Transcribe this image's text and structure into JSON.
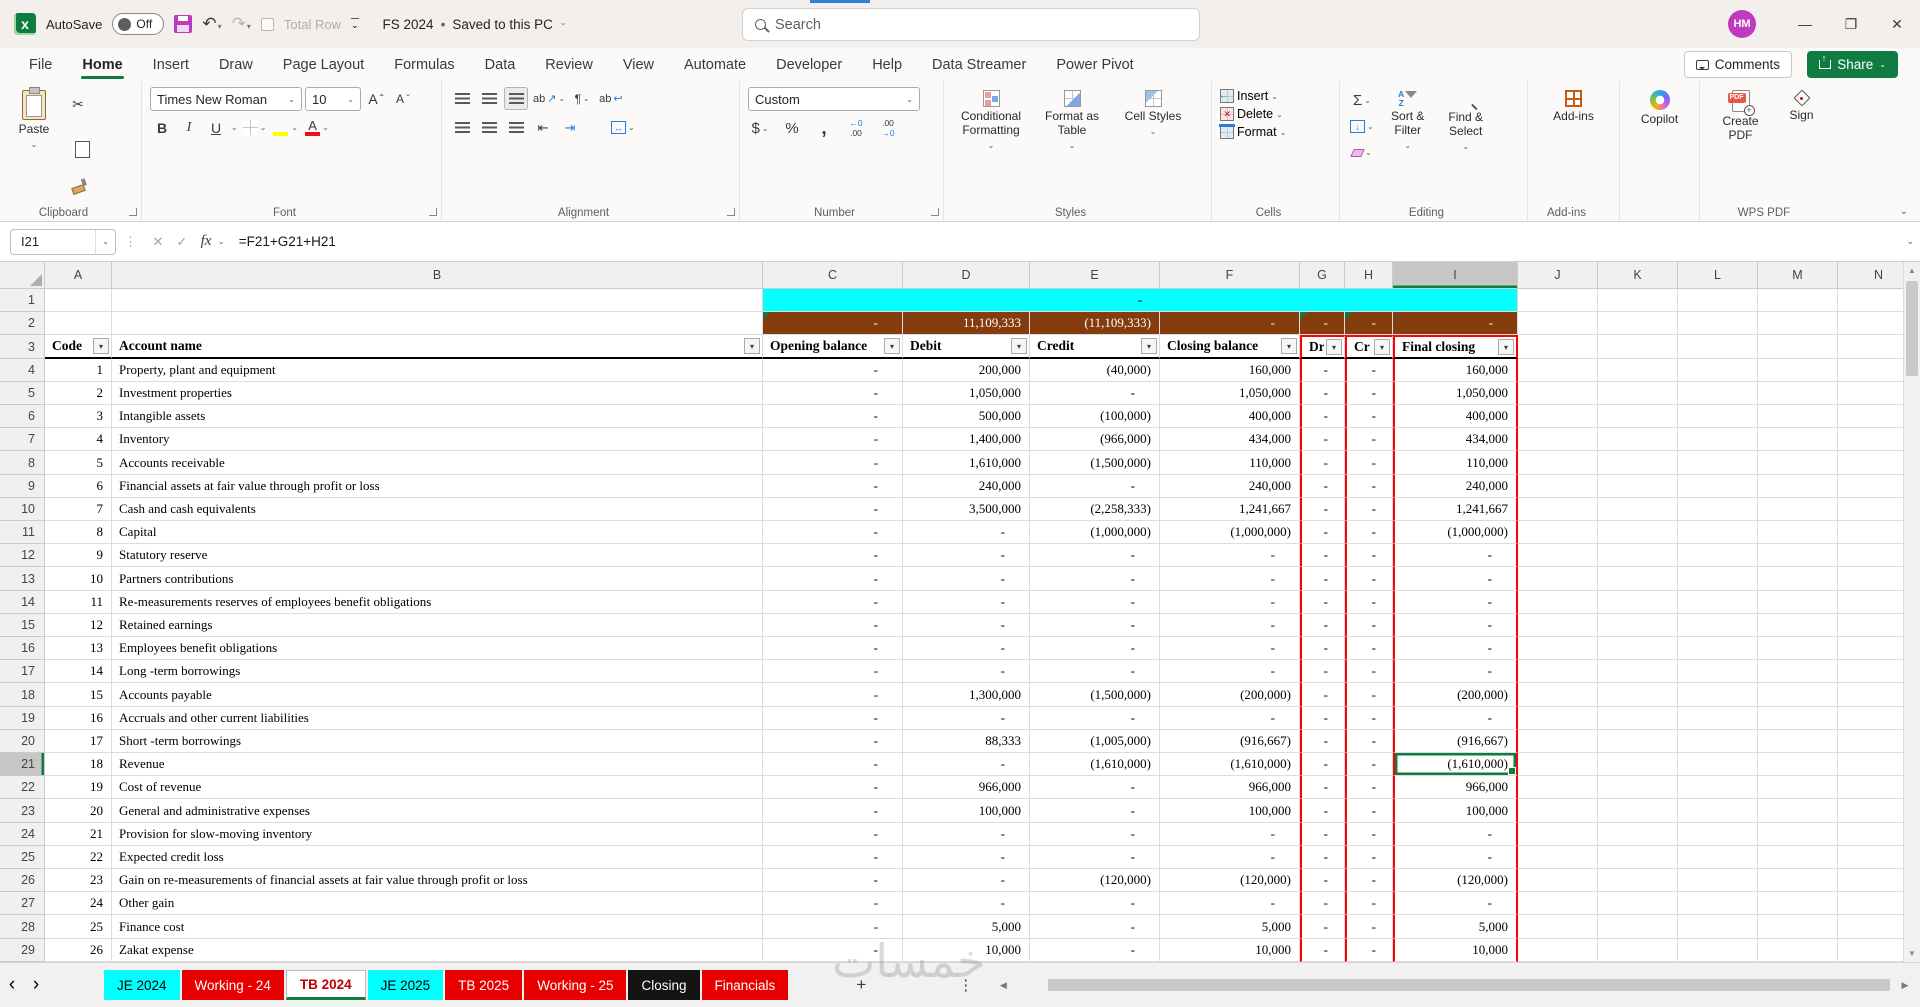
{
  "window": {
    "titlebar": {
      "autosave_label": "AutoSave",
      "autosave_state": "Off",
      "total_row_label": "Total Row",
      "doc_name": "FS 2024",
      "doc_sep": "•",
      "doc_status": "Saved to this PC",
      "search_placeholder": "Search",
      "avatar": "HM"
    },
    "controls": {
      "minimize": "—",
      "restore": "❐",
      "close": "✕"
    }
  },
  "menu": {
    "tabs": [
      {
        "label": "File"
      },
      {
        "label": "Home",
        "active": true
      },
      {
        "label": "Insert"
      },
      {
        "label": "Draw"
      },
      {
        "label": "Page Layout"
      },
      {
        "label": "Formulas"
      },
      {
        "label": "Data"
      },
      {
        "label": "Review"
      },
      {
        "label": "View"
      },
      {
        "label": "Automate"
      },
      {
        "label": "Developer"
      },
      {
        "label": "Help"
      },
      {
        "label": "Data Streamer"
      },
      {
        "label": "Power Pivot"
      }
    ],
    "comments_label": "Comments",
    "share_label": "Share"
  },
  "icons": {
    "caret": "▾",
    "chev": "⌄",
    "undo": "↶",
    "redo": "↷",
    "scissors": "✂",
    "filter": "▾",
    "dots_v": "⋮",
    "nav_l": "‹",
    "nav_r": "›",
    "tri_l": "◀",
    "tri_r": "▶",
    "tri_u": "▲",
    "tri_d": "▼",
    "plus": "+",
    "down": "↓",
    "lr": "↔",
    "wrap": "↩",
    "orient": "↗",
    "para": "¶",
    "ind_l": "⇤",
    "ind_r": "⇥",
    "up_hat": "ˆ",
    "down_hat": "ˇ",
    "ab": "ab",
    "az1": "A",
    "az2": "Z",
    "inc1": "←0",
    "inc2": ".00",
    "dec1": ".00",
    "dec2": "→0"
  },
  "ribbon": {
    "clipboard": {
      "group": "Clipboard",
      "paste": "Paste"
    },
    "font": {
      "group": "Font",
      "name": "Times New Roman",
      "size": "10",
      "bold": "B",
      "italic": "I",
      "underline": "U",
      "a": "A"
    },
    "alignment": {
      "group": "Alignment"
    },
    "number": {
      "group": "Number",
      "format": "Custom",
      "currency": "$",
      "percent": "%",
      "comma": ","
    },
    "styles": {
      "group": "Styles",
      "buttons": [
        {
          "label": "Conditional Formatting",
          "icon": "cf",
          "caret": true
        },
        {
          "label": "Format as Table",
          "icon": "fat",
          "caret": true
        },
        {
          "label": "Cell Styles",
          "icon": "cs",
          "caret": true
        }
      ]
    },
    "cells": {
      "group": "Cells",
      "buttons": [
        {
          "label": "Insert",
          "icon": "ins",
          "caret": true
        },
        {
          "label": "Delete",
          "icon": "del",
          "caret": true
        },
        {
          "label": "Format",
          "icon": "fmt",
          "caret": true
        }
      ]
    },
    "editing": {
      "group": "Editing",
      "sum": "Σ",
      "sort": "Sort & Filter",
      "find": "Find & Select"
    },
    "addins": {
      "group": "Add-ins",
      "button": "Add-ins"
    },
    "copilot": {
      "button": "Copilot"
    },
    "wpspdf": {
      "group": "WPS PDF",
      "buttons": [
        {
          "label": "Create PDF",
          "icon": "pdf"
        },
        {
          "label": "Sign",
          "icon": "sign"
        }
      ]
    }
  },
  "formula_bar": {
    "name_box": "I21",
    "cancel": "✕",
    "enter": "✓",
    "fx": "fx",
    "formula": "=F21+G21+H21"
  },
  "grid": {
    "col_letters": [
      "A",
      "B",
      "C",
      "D",
      "E",
      "F",
      "G",
      "H",
      "I",
      "J",
      "K",
      "L",
      "M",
      "N"
    ],
    "selected_col": "I",
    "selected_row": 21,
    "row1_merged": "-",
    "row2": {
      "values": {
        "C": "-",
        "D": "11,109,333",
        "E": "(11,109,333)",
        "F": "-",
        "G": "-",
        "H": "-",
        "I": "-"
      },
      "error_markers": [
        "C",
        "G",
        "H"
      ]
    },
    "headers": {
      "A": "Code",
      "B": "Account name",
      "C": "Opening balance",
      "D": "Debit",
      "E": "Credit",
      "F": "Closing balance",
      "G": "Dr",
      "H": "Cr",
      "I": "Final closing"
    },
    "rows": [
      [
        "1",
        "Property, plant and equipment",
        "-",
        "200,000",
        "(40,000)",
        "160,000",
        "-",
        "-",
        "160,000"
      ],
      [
        "2",
        "Investment properties",
        "-",
        "1,050,000",
        "-",
        "1,050,000",
        "-",
        "-",
        "1,050,000"
      ],
      [
        "3",
        "Intangible assets",
        "-",
        "500,000",
        "(100,000)",
        "400,000",
        "-",
        "-",
        "400,000"
      ],
      [
        "4",
        "Inventory",
        "-",
        "1,400,000",
        "(966,000)",
        "434,000",
        "-",
        "-",
        "434,000"
      ],
      [
        "5",
        "Accounts receivable",
        "-",
        "1,610,000",
        "(1,500,000)",
        "110,000",
        "-",
        "-",
        "110,000"
      ],
      [
        "6",
        "Financial assets at fair value through profit or loss",
        "-",
        "240,000",
        "-",
        "240,000",
        "-",
        "-",
        "240,000"
      ],
      [
        "7",
        "Cash and cash equivalents",
        "-",
        "3,500,000",
        "(2,258,333)",
        "1,241,667",
        "-",
        "-",
        "1,241,667"
      ],
      [
        "8",
        "Capital",
        "-",
        "-",
        "(1,000,000)",
        "(1,000,000)",
        "-",
        "-",
        "(1,000,000)"
      ],
      [
        "9",
        "Statutory reserve",
        "-",
        "-",
        "-",
        "-",
        "-",
        "-",
        "-"
      ],
      [
        "10",
        "Partners contributions",
        "-",
        "-",
        "-",
        "-",
        "-",
        "-",
        "-"
      ],
      [
        "11",
        "Re-measurements reserves of employees benefit obligations",
        "-",
        "-",
        "-",
        "-",
        "-",
        "-",
        "-"
      ],
      [
        "12",
        "Retained earnings",
        "-",
        "-",
        "-",
        "-",
        "-",
        "-",
        "-"
      ],
      [
        "13",
        "Employees benefit obligations",
        "-",
        "-",
        "-",
        "-",
        "-",
        "-",
        "-"
      ],
      [
        "14",
        "Long -term borrowings",
        "-",
        "-",
        "-",
        "-",
        "-",
        "-",
        "-"
      ],
      [
        "15",
        "Accounts payable",
        "-",
        "1,300,000",
        "(1,500,000)",
        "(200,000)",
        "-",
        "-",
        "(200,000)"
      ],
      [
        "16",
        "Accruals and other current liabilities",
        "-",
        "-",
        "-",
        "-",
        "-",
        "-",
        "-"
      ],
      [
        "17",
        "Short -term borrowings",
        "-",
        "88,333",
        "(1,005,000)",
        "(916,667)",
        "-",
        "-",
        "(916,667)"
      ],
      [
        "18",
        "Revenue",
        "-",
        "-",
        "(1,610,000)",
        "(1,610,000)",
        "-",
        "-",
        "(1,610,000)"
      ],
      [
        "19",
        "Cost of revenue",
        "-",
        "966,000",
        "-",
        "966,000",
        "-",
        "-",
        "966,000"
      ],
      [
        "20",
        "General and administrative expenses",
        "-",
        "100,000",
        "-",
        "100,000",
        "-",
        "-",
        "100,000"
      ],
      [
        "21",
        "Provision for slow-moving inventory",
        "-",
        "-",
        "-",
        "-",
        "-",
        "-",
        "-"
      ],
      [
        "22",
        "Expected credit loss",
        "-",
        "-",
        "-",
        "-",
        "-",
        "-",
        "-"
      ],
      [
        "23",
        "Gain on re-measurements of financial assets at fair value through profit or loss",
        "-",
        "-",
        "(120,000)",
        "(120,000)",
        "-",
        "-",
        "(120,000)"
      ],
      [
        "24",
        "Other gain",
        "-",
        "-",
        "-",
        "-",
        "-",
        "-",
        "-"
      ],
      [
        "25",
        "Finance cost",
        "-",
        "5,000",
        "-",
        "5,000",
        "-",
        "-",
        "5,000"
      ],
      [
        "26",
        "Zakat expense",
        "-",
        "10,000",
        "-",
        "10,000",
        "-",
        "-",
        "10,000"
      ]
    ]
  },
  "sheet_bar": {
    "tabs": [
      {
        "label": "JE 2024",
        "bg": "#00FFFF",
        "fg": "#000000"
      },
      {
        "label": "Working - 24",
        "bg": "#E80000",
        "fg": "#FFFFFF"
      },
      {
        "label": "TB 2024",
        "bg": "#FFFFFF",
        "fg": "#C00000",
        "active": true
      },
      {
        "label": "JE 2025",
        "bg": "#00FFFF",
        "fg": "#000000"
      },
      {
        "label": "TB 2025",
        "bg": "#E80000",
        "fg": "#FFFFFF"
      },
      {
        "label": "Working - 25",
        "bg": "#E80000",
        "fg": "#FFFFFF"
      },
      {
        "label": "Closing",
        "bg": "#141414",
        "fg": "#FFFFFF"
      },
      {
        "label": "Financials",
        "bg": "#E80000",
        "fg": "#FFFFFF"
      }
    ]
  },
  "watermark": "خمسات",
  "colors": {
    "accent_green": "#107C41",
    "cyan_fill": "#00FFFF",
    "brown_fill": "#843C0C",
    "red_border": "#FF0000",
    "avatar": "#BE3BC0"
  }
}
